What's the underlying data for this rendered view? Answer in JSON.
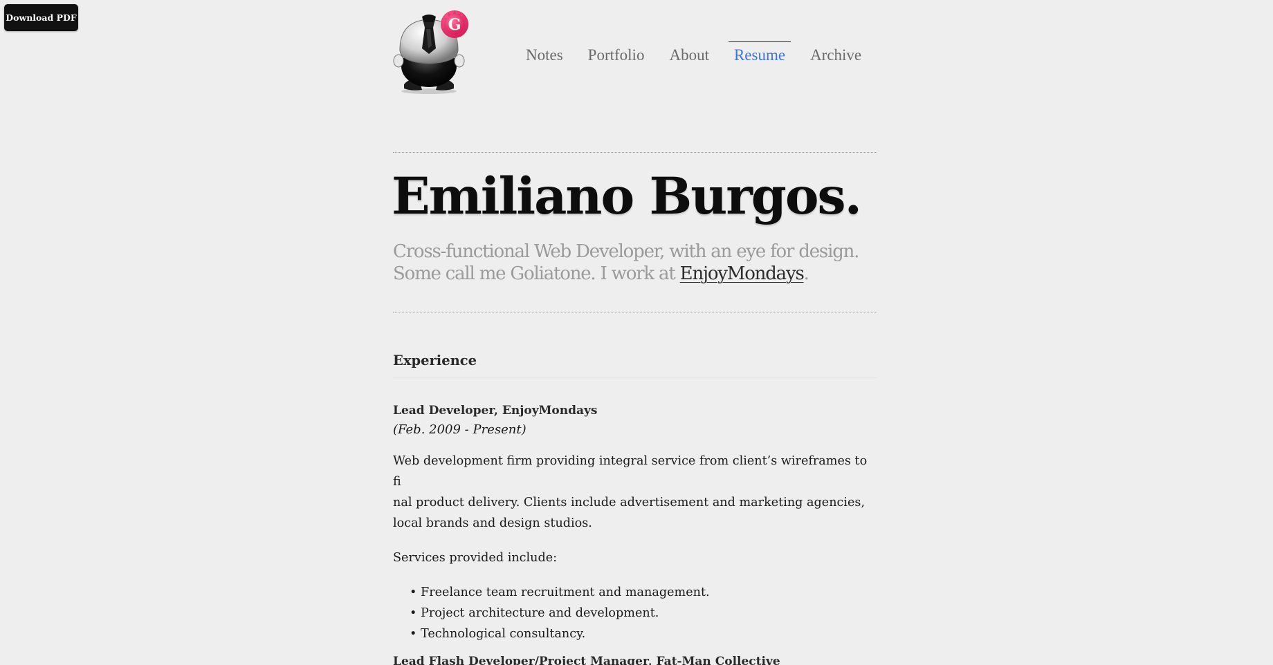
{
  "download_pdf_label": "Download PDF",
  "logo": {
    "badge_letter": "G",
    "badge_color": "#e8316f"
  },
  "nav": {
    "items": [
      {
        "label": "Notes",
        "active": false
      },
      {
        "label": "Portfolio",
        "active": false
      },
      {
        "label": "About",
        "active": false
      },
      {
        "label": "Resume",
        "active": true
      },
      {
        "label": "Archive",
        "active": false
      }
    ],
    "active_color": "#3d74e0"
  },
  "hero": {
    "name": "Emiliano Burgos.",
    "tagline_line1": "Cross-functional Web Developer, with an eye for design.",
    "tagline_line2_prefix": "Some call me Goliatone. I work at ",
    "tagline_link": "EnjoyMondays",
    "tagline_suffix": "."
  },
  "experience": {
    "section_title": "Experience",
    "jobs": [
      {
        "title": "Lead Developer, EnjoyMondays",
        "dates": "(Feb. 2009 - Present)",
        "description_lines": [
          "Web development firm providing integral service from client’s wireframes to fi",
          "nal product delivery. Clients include advertisement and marketing agencies,",
          "local brands and design studios."
        ],
        "services_intro": "Services provided include:",
        "services": [
          "Freelance team recruitment and management.",
          "Project architecture and development.",
          "Technological consultancy."
        ]
      },
      {
        "title": "Lead Flash Developer/Project Manager, Fat-Man Collective"
      }
    ]
  }
}
